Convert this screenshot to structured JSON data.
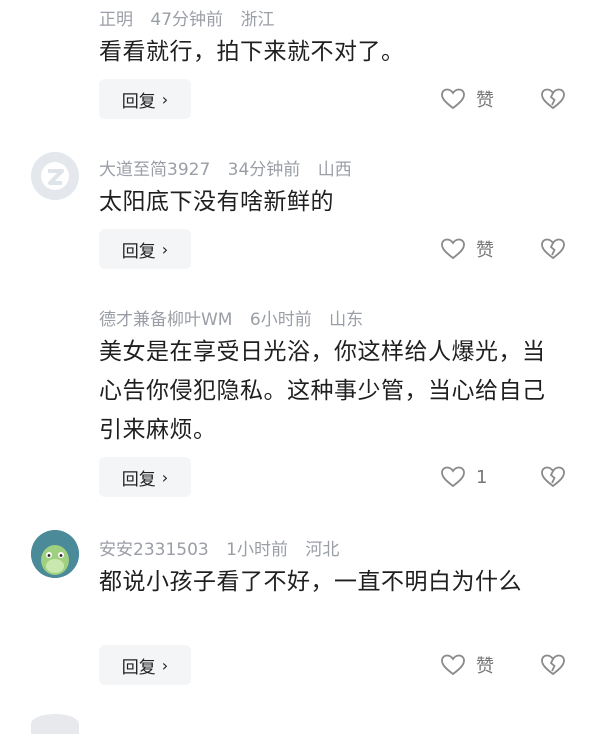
{
  "comments": [
    {
      "user": "正明",
      "time": "47分钟前",
      "region": "浙江",
      "text": "看看就行，拍下来就不对了。",
      "reply_label": "回复",
      "like_label": "赞",
      "avatar": "none"
    },
    {
      "user": "大道至简3927",
      "time": "34分钟前",
      "region": "山西",
      "text": "太阳底下没有啥新鲜的",
      "reply_label": "回复",
      "like_label": "赞",
      "avatar": "default-avatar-icon"
    },
    {
      "user": "德才兼备柳叶WM",
      "time": "6小时前",
      "region": "山东",
      "text": "美女是在享受日光浴，你这样给人爆光，当心告你侵犯隐私。这种事少管，当心给自己引来麻烦。",
      "reply_label": "回复",
      "like_label": "1",
      "avatar": "none"
    },
    {
      "user": "安安2331503",
      "time": "1小时前",
      "region": "河北",
      "text": "都说小孩子看了不好，一直不明白为什么",
      "reply_label": "回复",
      "like_label": "赞",
      "avatar": "cartoon-avatar"
    }
  ],
  "colors": {
    "meta": "#9a9ea6",
    "text": "#1f1f1f",
    "reply_bg": "#f4f5f7",
    "icon": "#8a8a8a"
  }
}
